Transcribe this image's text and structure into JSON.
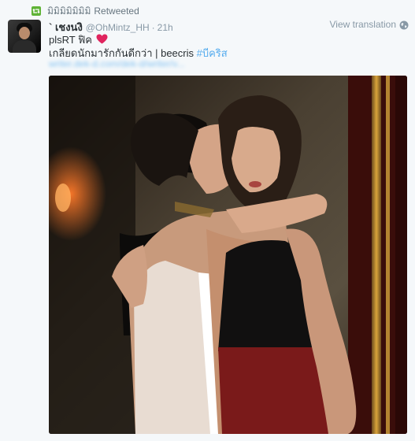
{
  "retweet": {
    "by_name": "มิมิมิมิมิมิมิ",
    "label": "Retweeted"
  },
  "tweet": {
    "fullname": "` เชงนงิ",
    "username": "@OhMintz_HH",
    "separator": "·",
    "time": "21h",
    "view_translation": "View translation",
    "line1": "plsRT ฟิค",
    "line2_text": "เกลียดนักมารักกันดีกว่า | beecris ",
    "line2_hashtag": "#บีคริส",
    "line3_link": "writer.dek-d.com/dek-d/writer/v..."
  },
  "colors": {
    "background": "#f5f8fa",
    "link": "#55acee",
    "muted": "#8899a6",
    "retweet_green": "#5fb336",
    "heart_red": "#e0245e"
  },
  "icons": {
    "retweet": "retweet-icon",
    "globe": "globe-icon",
    "heart": "heart-icon"
  }
}
